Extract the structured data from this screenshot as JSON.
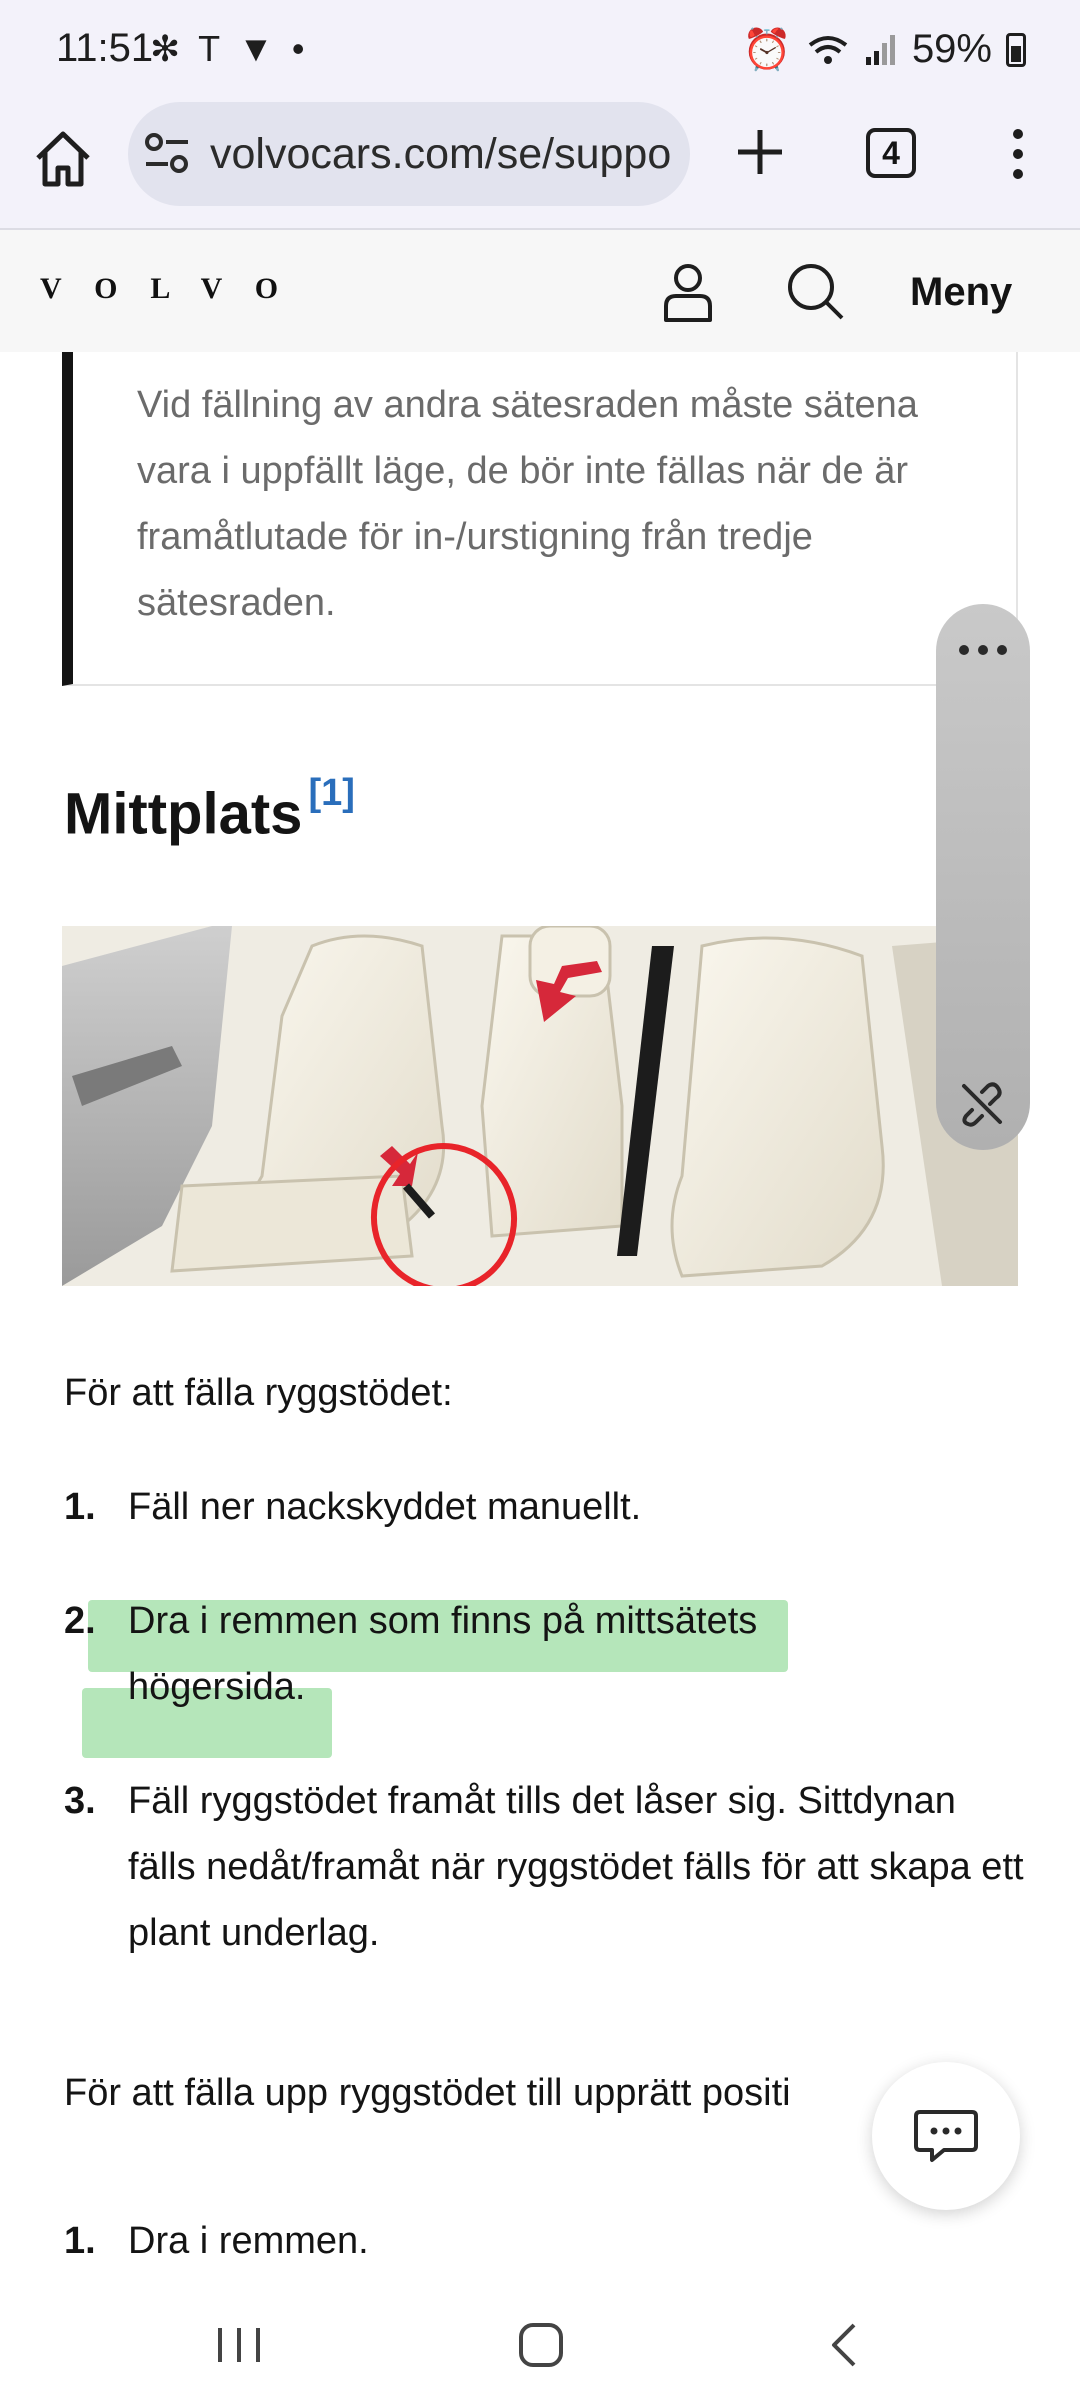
{
  "status_bar": {
    "time": "11:51",
    "battery": "59%"
  },
  "browser": {
    "url": "volvocars.com/se/suppo",
    "tab_count": "4"
  },
  "site_header": {
    "logo": "VOLVO",
    "menu_label": "Meny"
  },
  "note": {
    "text": "Vid fällning av andra sätesraden måste sä­tena vara i uppfällt läge, de bör inte fällas när de är framåtlutade för in-/urstigning från tredje sätesraden."
  },
  "section": {
    "heading": "Mittplats",
    "footnote": "[1]",
    "intro": "För att fälla ryggstödet:",
    "steps": [
      {
        "num": "1.",
        "text": "Fäll ner nackskyddet manuellt."
      },
      {
        "num": "2.",
        "text": "Dra i remmen som finns på mittsätets högersida."
      },
      {
        "num": "3.",
        "text": "Fäll ryggstödet framåt tills det låser sig. Sittdynan fälls nedåt/framåt när ryggstödet fälls för att skapa ett plant underlag."
      }
    ],
    "intro2": "För att fälla upp ryggstödet till upprätt positi",
    "steps2": [
      {
        "num": "1.",
        "text": "Dra i remmen."
      }
    ]
  },
  "colors": {
    "accent": "#2a6ebb",
    "highlight": "#78d282",
    "annotation_red": "#e8242a",
    "arrow_red": "#d6283a"
  },
  "icons": [
    "home-icon",
    "tune-icon",
    "plus-icon",
    "tabs-icon",
    "more-vert-icon",
    "user-icon",
    "search-icon",
    "more-horiz-icon",
    "unlink-icon",
    "chat-icon",
    "nav-recents-icon",
    "nav-home-icon",
    "nav-back-icon"
  ]
}
